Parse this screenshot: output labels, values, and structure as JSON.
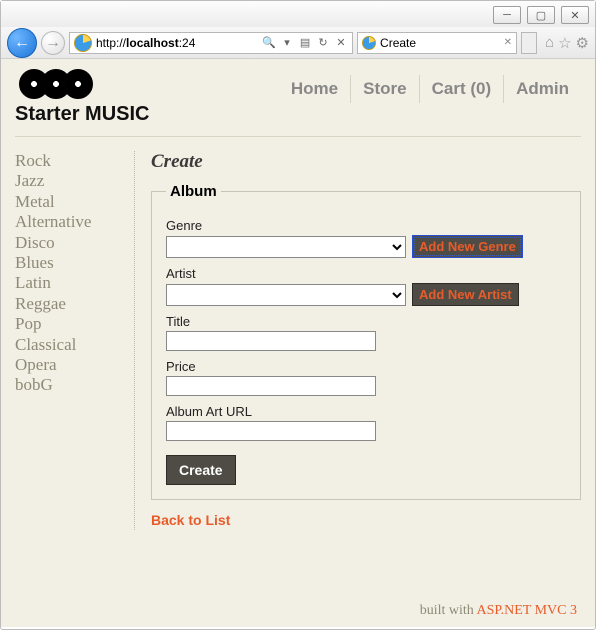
{
  "browser": {
    "url_prefix": "http://",
    "url_bold": "localhost",
    "url_suffix": ":24",
    "tab_title": "Create"
  },
  "site": {
    "title": "Starter MUSIC"
  },
  "nav": {
    "home": "Home",
    "store": "Store",
    "cart": "Cart (0)",
    "admin": "Admin"
  },
  "sidebar": {
    "items": [
      "Rock",
      "Jazz",
      "Metal",
      "Alternative",
      "Disco",
      "Blues",
      "Latin",
      "Reggae",
      "Pop",
      "Classical",
      "Opera",
      "bobG"
    ]
  },
  "page": {
    "heading": "Create",
    "legend": "Album",
    "genre_label": "Genre",
    "add_genre": "Add New Genre",
    "artist_label": "Artist",
    "add_artist": "Add New Artist",
    "title_label": "Title",
    "price_label": "Price",
    "arturl_label": "Album Art URL",
    "create_btn": "Create",
    "back": "Back to List"
  },
  "footer": {
    "prefix": "built with ",
    "link": "ASP.NET MVC 3"
  }
}
